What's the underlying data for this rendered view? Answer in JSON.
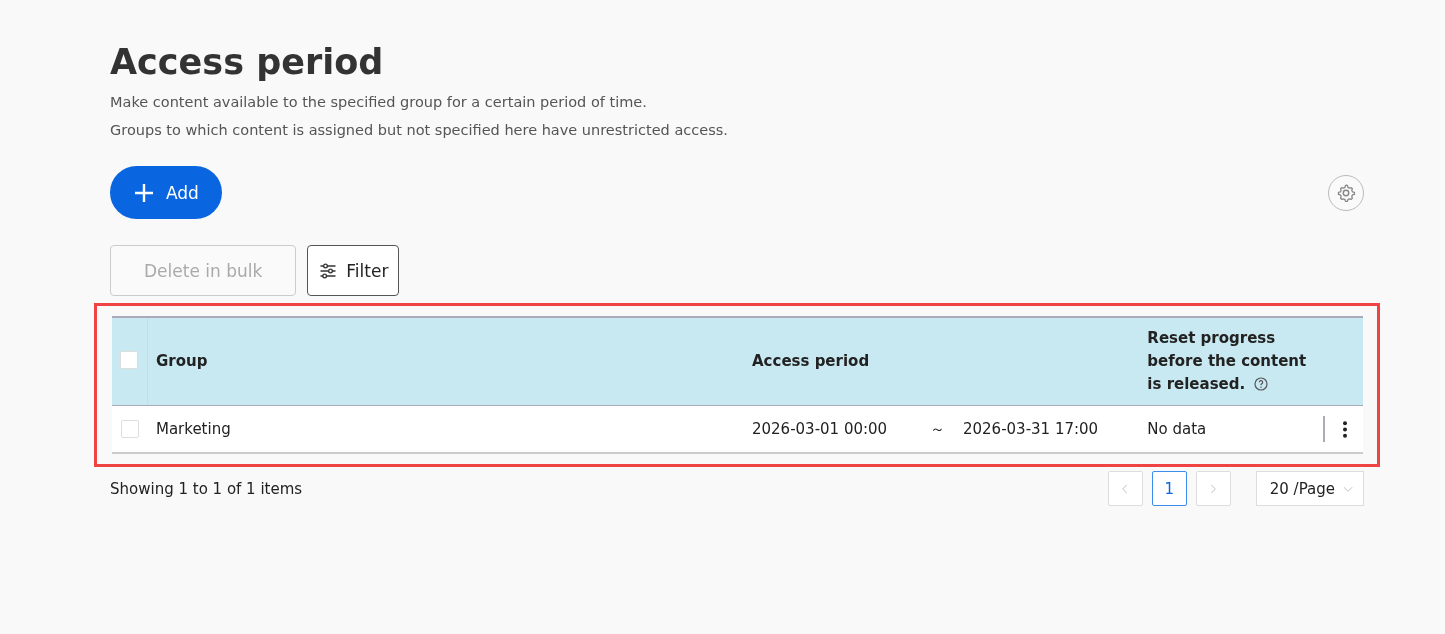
{
  "page": {
    "title": "Access period",
    "descriptions": [
      "Make content available to the specified group for a certain period of time.",
      "Groups to which content is assigned but not specified here have unrestricted access."
    ]
  },
  "add_button": {
    "label": "Add"
  },
  "toolbar": [
    {
      "kind": "delete",
      "label": "Delete in bulk",
      "disabled": true
    },
    {
      "kind": "filter",
      "label": "Filter",
      "disabled": false
    }
  ],
  "table": {
    "highlighted": true,
    "select_all": {
      "checked": false
    },
    "columns": [
      {
        "label": "Group",
        "help": false
      },
      {
        "label": "Access period",
        "help": false
      },
      {
        "label": "Reset progress before the content is released.",
        "help": true
      }
    ],
    "rows": [
      {
        "checked": false,
        "group": "Marketing",
        "start": "2026-03-01 00:00",
        "separator": "～",
        "end": "2026-03-31 17:00",
        "reset": "No data"
      }
    ]
  },
  "footer": {
    "summary": "Showing 1 to 1 of 1 items",
    "pages": [
      {
        "label": "1",
        "selected": true
      }
    ],
    "page_size": "20 /Page"
  }
}
